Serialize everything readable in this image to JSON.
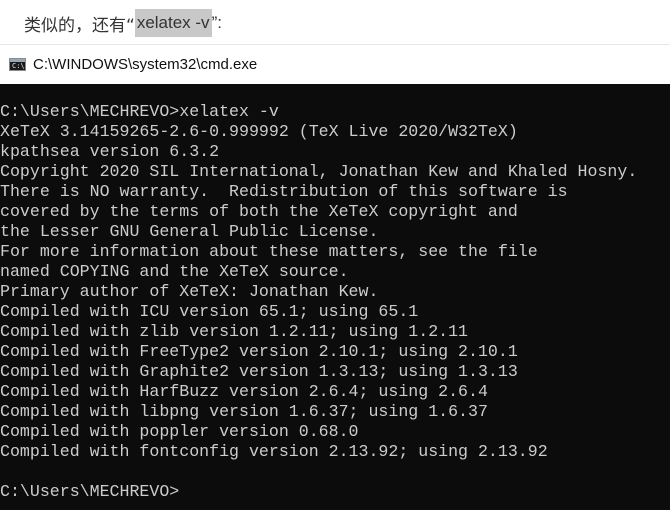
{
  "article": {
    "text_before": "类似的，还有“",
    "highlight": "xelatex -v",
    "text_after": "”:"
  },
  "window": {
    "title": "C:\\WINDOWS\\system32\\cmd.exe",
    "icon_glyph": "C:\\"
  },
  "console": {
    "lines": [
      "C:\\Users\\MECHREVO>xelatex -v",
      "XeTeX 3.14159265-2.6-0.999992 (TeX Live 2020/W32TeX)",
      "kpathsea version 6.3.2",
      "Copyright 2020 SIL International, Jonathan Kew and Khaled Hosny.",
      "There is NO warranty.  Redistribution of this software is",
      "covered by the terms of both the XeTeX copyright and",
      "the Lesser GNU General Public License.",
      "For more information about these matters, see the file",
      "named COPYING and the XeTeX source.",
      "Primary author of XeTeX: Jonathan Kew.",
      "Compiled with ICU version 65.1; using 65.1",
      "Compiled with zlib version 1.2.11; using 1.2.11",
      "Compiled with FreeType2 version 2.10.1; using 2.10.1",
      "Compiled with Graphite2 version 1.3.13; using 1.3.13",
      "Compiled with HarfBuzz version 2.6.4; using 2.6.4",
      "Compiled with libpng version 1.6.37; using 1.6.37",
      "Compiled with poppler version 0.68.0",
      "Compiled with fontconfig version 2.13.92; using 2.13.92",
      "",
      "C:\\Users\\MECHREVO>"
    ]
  },
  "colors": {
    "console_background": "#0c0c0c",
    "console_text": "#cccccc",
    "highlight_background": "#c8c8c8"
  }
}
